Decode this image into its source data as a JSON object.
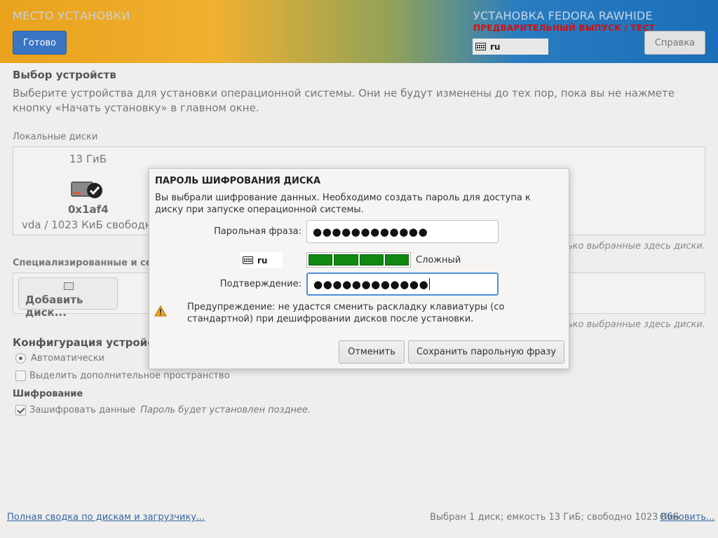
{
  "header": {
    "spoke_title": "МЕСТО УСТАНОВКИ",
    "done_label": "Готово",
    "distro_title": "УСТАНОВКА FEDORA RAWHIDE",
    "prerelease": "ПРЕДВАРИТЕЛЬНЫЙ ВЫПУСК / ТЕСТ",
    "keyboard_layout": "ru",
    "help_label": "Справка"
  },
  "main": {
    "device_selection_title": "Выбор устройств",
    "device_selection_desc": "Выберите устройства для установки операционной системы. Они не будут изменены до тех пор, пока вы не нажмете кнопку «Начать установку» в главном окне.",
    "local_disks_label": "Локальные диски",
    "disk": {
      "size": "13 ГиБ",
      "id": "0x1af4",
      "free": "vda / 1023 КиБ свободно"
    },
    "local_note": "только выбранные здесь диски.",
    "specialized_label": "Специализированные и сетевые диски",
    "add_disk_label": "Добавить диск...",
    "specialized_note": "только выбранные здесь диски.",
    "storage_config_title": "Конфигурация устройств хранения",
    "auto_label": "Автоматически",
    "extra_space_label": "Выделить дополнительное пространство",
    "encryption_title": "Шифрование",
    "encrypt_label": "Зашифровать данные",
    "encrypt_note": "Пароль будет установлен позднее.",
    "footer_summary_link": "Полная сводка по дискам и загрузчику...",
    "footer_status": "Выбран 1 диск; емкость 13 ГиБ; свободно 1023 КиБ",
    "footer_refresh_link": "Обновить..."
  },
  "dialog": {
    "title": "ПАРОЛЬ ШИФРОВАНИЯ ДИСКА",
    "description": "Вы выбрали шифрование данных. Необходимо создать пароль для доступа к диску при запуске операционной системы.",
    "passphrase_label": "Парольная фраза:",
    "passphrase_value": "●●●●●●●●●●●●",
    "keyboard_layout": "ru",
    "strength_label": "Сложный",
    "strength_fraction": 1.0,
    "confirm_label": "Подтверждение:",
    "confirm_value": "●●●●●●●●●●●●",
    "warning_text": "Предупреждение: не удастся сменить раскладку клавиатуры (со стандартной) при дешифровании дисков после установки.",
    "cancel_label": "Отменить",
    "save_label": "Сохранить парольную фразу"
  }
}
